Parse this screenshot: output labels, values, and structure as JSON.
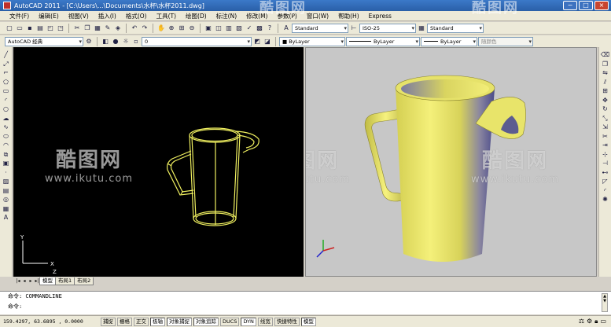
{
  "window": {
    "title": "AutoCAD 2011 - [C:\\Users\\...\\Documents\\水杯\\水杯2011.dwg]",
    "buttons": {
      "minimize": "−",
      "maximize": "□",
      "close": "×"
    }
  },
  "menu": [
    "文件(F)",
    "编辑(E)",
    "视图(V)",
    "插入(I)",
    "格式(O)",
    "工具(T)",
    "绘图(D)",
    "标注(N)",
    "修改(M)",
    "参数(P)",
    "窗口(W)",
    "帮助(H)",
    "Express"
  ],
  "toolbar_styles": {
    "text_style": "Standard",
    "dim_style": "ISO-25",
    "table_style": "Standard"
  },
  "toolbar_layers": {
    "workspace": "AutoCAD 经典",
    "layer": "0",
    "color": "ByLayer",
    "linetype": "ByLayer",
    "lineweight": "ByLayer",
    "plot_style": "随颜色"
  },
  "tabs": {
    "model": "模型",
    "layouts": [
      "布局1",
      "布局2"
    ]
  },
  "command": {
    "history": "命令: COMMANDLINE",
    "prompt": "命令:"
  },
  "status": {
    "coordinates": "159.4297, 63.6895 , 0.0000",
    "toggles": [
      "捕捉",
      "栅格",
      "正交",
      "极轴",
      "对象捕捉",
      "对象追踪",
      "DUCS",
      "DYN",
      "线宽",
      "快捷特性",
      "模型"
    ]
  },
  "watermark": {
    "brand": "酷图网",
    "url": "www.ikutu.com"
  },
  "colors": {
    "viewport_left_bg": "#000000",
    "viewport_right_bg": "#c7c7c7",
    "wireframe": "#f0f060",
    "mug_light": "#f4f07a",
    "mug_dark": "#4a4a8a",
    "title_bar": "#2a5fa8"
  },
  "icons": {
    "left_toolbar": [
      "line-icon",
      "construction-line-icon",
      "polyline-icon",
      "polygon-icon",
      "rectangle-icon",
      "arc-icon",
      "circle-icon",
      "revision-cloud-icon",
      "spline-icon",
      "ellipse-icon",
      "ellipse-arc-icon",
      "insert-block-icon",
      "make-block-icon",
      "point-icon",
      "hatch-icon",
      "gradient-icon",
      "region-icon",
      "table-icon",
      "mtext-icon"
    ],
    "right_toolbar": [
      "erase-icon",
      "copy-icon",
      "mirror-icon",
      "offset-icon",
      "array-icon",
      "move-icon",
      "rotate-icon",
      "scale-icon",
      "stretch-icon",
      "trim-icon",
      "extend-icon",
      "break-at-point-icon",
      "break-icon",
      "join-icon",
      "chamfer-icon",
      "fillet-icon",
      "explode-icon"
    ]
  }
}
